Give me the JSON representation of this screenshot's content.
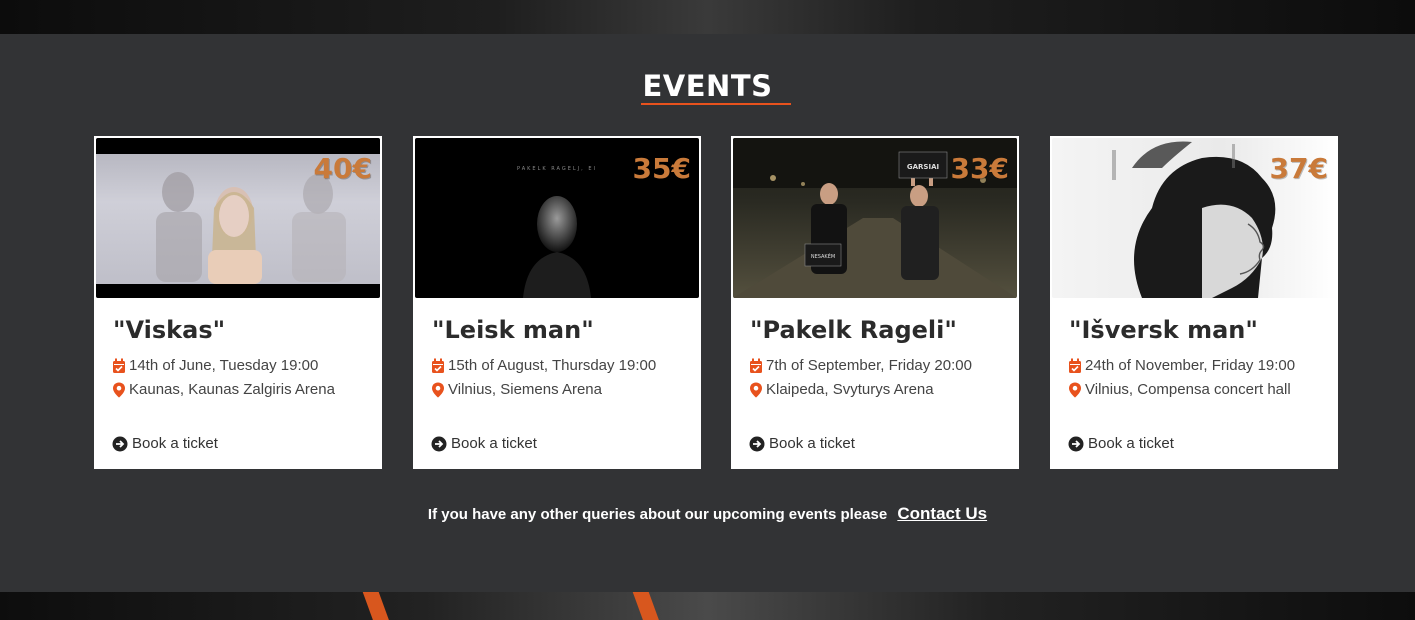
{
  "section": {
    "title": "EVENTS",
    "accent_color": "#e8521d",
    "price_color": "#c97a3a"
  },
  "events": [
    {
      "price": "40€",
      "name": "\"Viskas\"",
      "date": "14th of June, Tuesday 19:00",
      "location": "Kaunas, Kaunas Zalgiris Arena",
      "book_label": "Book a ticket"
    },
    {
      "price": "35€",
      "name": "\"Leisk man\"",
      "date": "15th of August, Thursday 19:00",
      "location": "Vilnius, Siemens Arena",
      "book_label": "Book a ticket",
      "poster_text": "PAKELK RAGELJ, EI"
    },
    {
      "price": "33€",
      "name": "\"Pakelk Rageli\"",
      "date": "7th of September, Friday 20:00",
      "location": "Klaipeda, Svyturys Arena",
      "book_label": "Book a ticket",
      "sign_top": "GARSIAI",
      "sign_bottom": "NESAKĖM"
    },
    {
      "price": "37€",
      "name": "\"Išversk man\"",
      "date": "24th of November, Friday 19:00",
      "location": "Vilnius, Compensa concert hall",
      "book_label": "Book a ticket"
    }
  ],
  "footer": {
    "text": "If you have any other queries about our upcoming events please",
    "link_label": "Contact Us"
  },
  "icons": {
    "calendar": "calendar-check-icon",
    "location": "map-marker-icon",
    "book": "arrow-circle-right-icon"
  }
}
